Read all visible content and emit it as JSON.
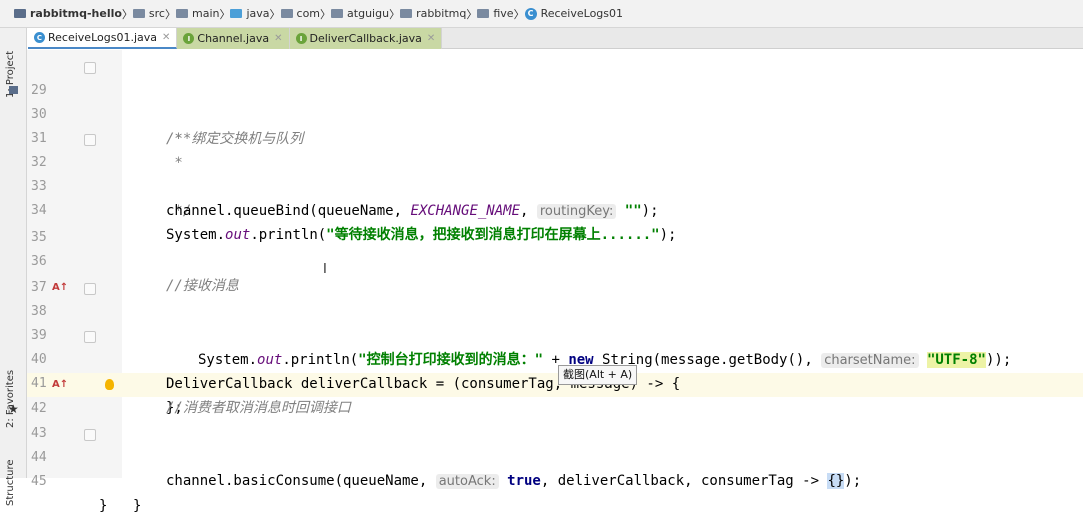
{
  "breadcrumb": [
    {
      "label": "rabbitmq-hello",
      "kind": "project"
    },
    {
      "label": "src",
      "kind": "folder"
    },
    {
      "label": "main",
      "kind": "folder"
    },
    {
      "label": "java",
      "kind": "folder"
    },
    {
      "label": "com",
      "kind": "package"
    },
    {
      "label": "atguigu",
      "kind": "package"
    },
    {
      "label": "rabbitmq",
      "kind": "package"
    },
    {
      "label": "five",
      "kind": "package"
    },
    {
      "label": "ReceiveLogs01",
      "kind": "class"
    }
  ],
  "tabs": [
    {
      "label": "ReceiveLogs01.java",
      "icon": "C",
      "active": true
    },
    {
      "label": "Channel.java",
      "icon": "I",
      "active": false
    },
    {
      "label": "DeliverCallback.java",
      "icon": "I",
      "active": false
    }
  ],
  "tool_windows": {
    "project": "1: Project",
    "favorites": "2: Favorites",
    "structure": "Structure"
  },
  "lines": [
    {
      "num": "29",
      "code": "/**"
    },
    {
      "num": "30",
      "code": " * 绑定交换机与队列"
    },
    {
      "num": "31",
      "code": " *"
    },
    {
      "num": "32",
      "code": " */"
    },
    {
      "num": "33",
      "code_a": "channel.queueBind(queueName, ",
      "code_const": "EXCHANGE_NAME",
      "code_b": ", ",
      "hint": "routingKey:",
      "code_str": "\"\"",
      "code_c": ");"
    },
    {
      "num": "34",
      "code_a": "System.",
      "code_out": "out",
      "code_b": ".println(",
      "code_str": "\"等待接收消息，把接收到消息打印在屏幕上......\"",
      "code_c": ");"
    },
    {
      "num": "35"
    },
    {
      "num": "36",
      "code": "//接收消息"
    },
    {
      "num": "37"
    },
    {
      "num": "38",
      "code": "DeliverCallback deliverCallback = (consumerTag, message) -> {"
    },
    {
      "num": "39",
      "code_a": "System.",
      "code_out": "out",
      "code_b": ".println(",
      "code_str": "\"控制台打印接收到的消息：\"",
      "code_c": " + ",
      "code_kw": "new",
      "code_d": " String(message.getBody(), ",
      "hint": "charsetName:",
      "code_str2": "\"UTF-8\"",
      "code_e": "));"
    },
    {
      "num": "40",
      "code": "};"
    },
    {
      "num": "41",
      "code": "//消费者取消消息时回调接口"
    },
    {
      "num": "42",
      "code_a": "channel.basicConsume(queueName, ",
      "hint": "autoAck:",
      "code_kw": "true",
      "code_b": ", deliverCallback, consumerTag -> ",
      "code_br": "{}",
      "code_c": ");"
    },
    {
      "num": "43"
    },
    {
      "num": "44",
      "code": "}"
    },
    {
      "num": "45",
      "code": "}"
    }
  ],
  "tooltip": "截图(Alt + A)",
  "cursor_glyph": "I"
}
